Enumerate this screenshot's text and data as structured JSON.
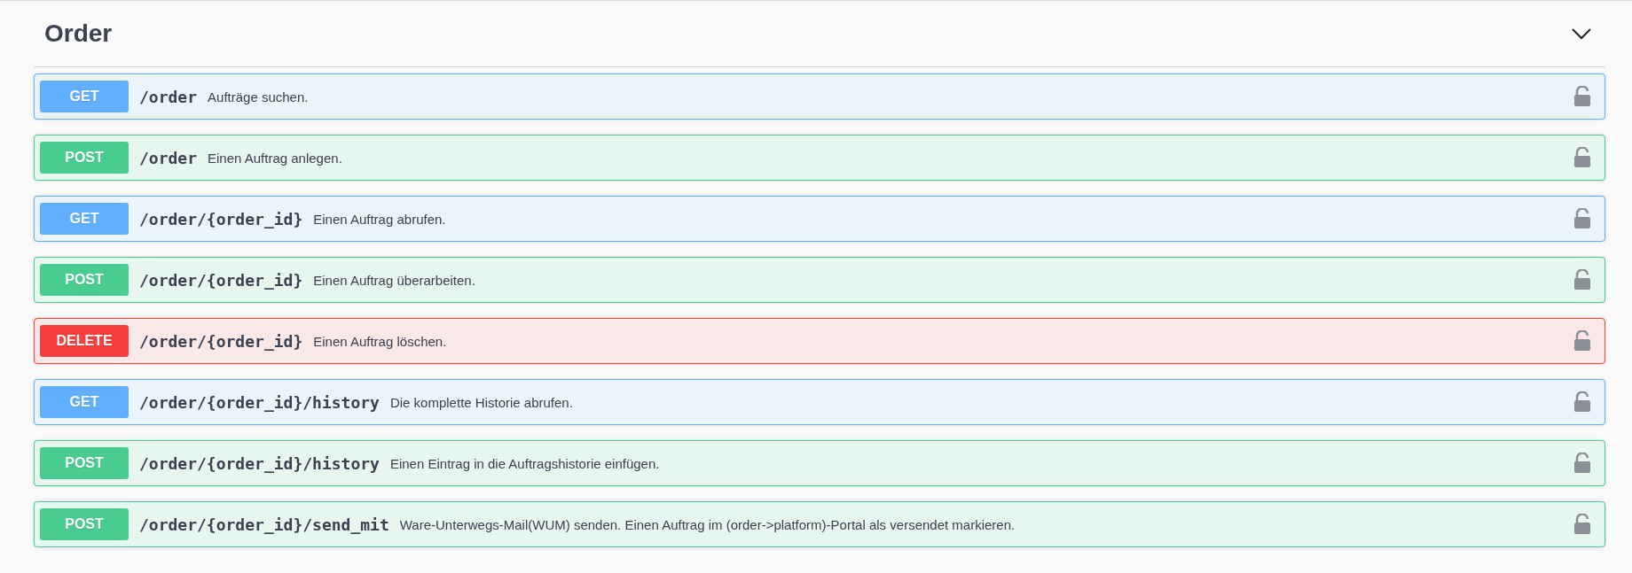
{
  "section": {
    "title": "Order",
    "expanded": true
  },
  "operations": [
    {
      "method": "GET",
      "path": "/order",
      "summary": "Aufträge suchen."
    },
    {
      "method": "POST",
      "path": "/order",
      "summary": "Einen Auftrag anlegen."
    },
    {
      "method": "GET",
      "path": "/order/{order_id}",
      "summary": "Einen Auftrag abrufen."
    },
    {
      "method": "POST",
      "path": "/order/{order_id}",
      "summary": "Einen Auftrag überarbeiten."
    },
    {
      "method": "DELETE",
      "path": "/order/{order_id}",
      "summary": "Einen Auftrag löschen."
    },
    {
      "method": "GET",
      "path": "/order/{order_id}/history",
      "summary": "Die komplette Historie abrufen."
    },
    {
      "method": "POST",
      "path": "/order/{order_id}/history",
      "summary": "Einen Eintrag in die Auftragshistorie einfügen."
    },
    {
      "method": "POST",
      "path": "/order/{order_id}/send_mit",
      "summary": "Ware-Unterwegs-Mail(WUM) senden. Einen Auftrag im (order->platform)-Portal als versendet markieren."
    }
  ]
}
